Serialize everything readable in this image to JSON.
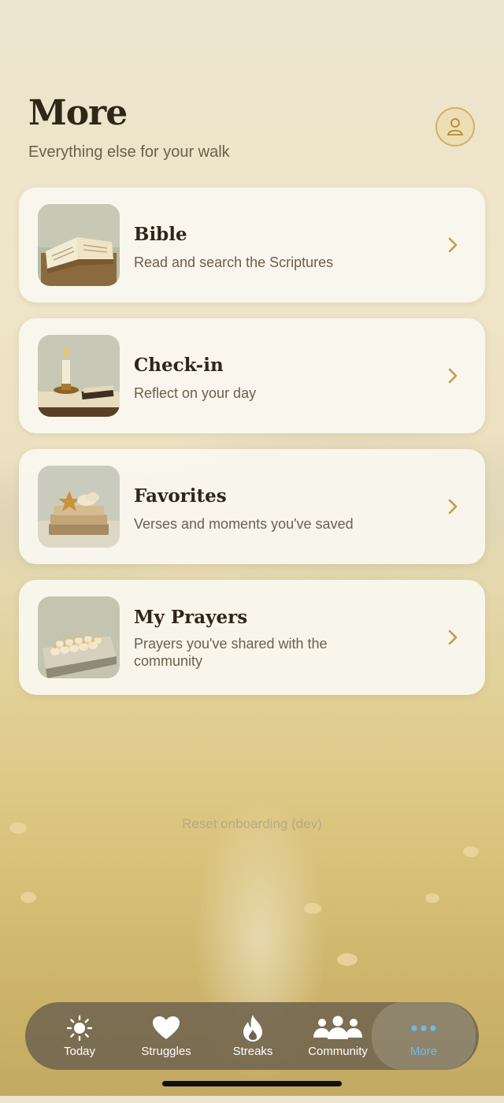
{
  "header": {
    "title": "More",
    "subtitle": "Everything else for your walk",
    "profile_icon": "person-icon"
  },
  "menu": [
    {
      "title": "Bible",
      "subtitle": "Read and search the Scriptures",
      "image": "open-book"
    },
    {
      "title": "Check-in",
      "subtitle": "Reflect on your day",
      "image": "candle"
    },
    {
      "title": "Favorites",
      "subtitle": "Verses and moments you've saved",
      "image": "books-with-star"
    },
    {
      "title": "My Prayers",
      "subtitle": "Prayers you've shared with the community",
      "image": "tealight-candles"
    }
  ],
  "dev_link": "Reset onboarding (dev)",
  "tabs": [
    {
      "label": "Today",
      "icon": "sun-icon"
    },
    {
      "label": "Struggles",
      "icon": "heart-icon"
    },
    {
      "label": "Streaks",
      "icon": "flame-icon"
    },
    {
      "label": "Community",
      "icon": "people-icon"
    },
    {
      "label": "More",
      "icon": "more-dots-icon",
      "active": true
    }
  ],
  "colors": {
    "accent_active": "#74b7e8",
    "title_text": "#2f2618",
    "gold": "#d4b066"
  }
}
